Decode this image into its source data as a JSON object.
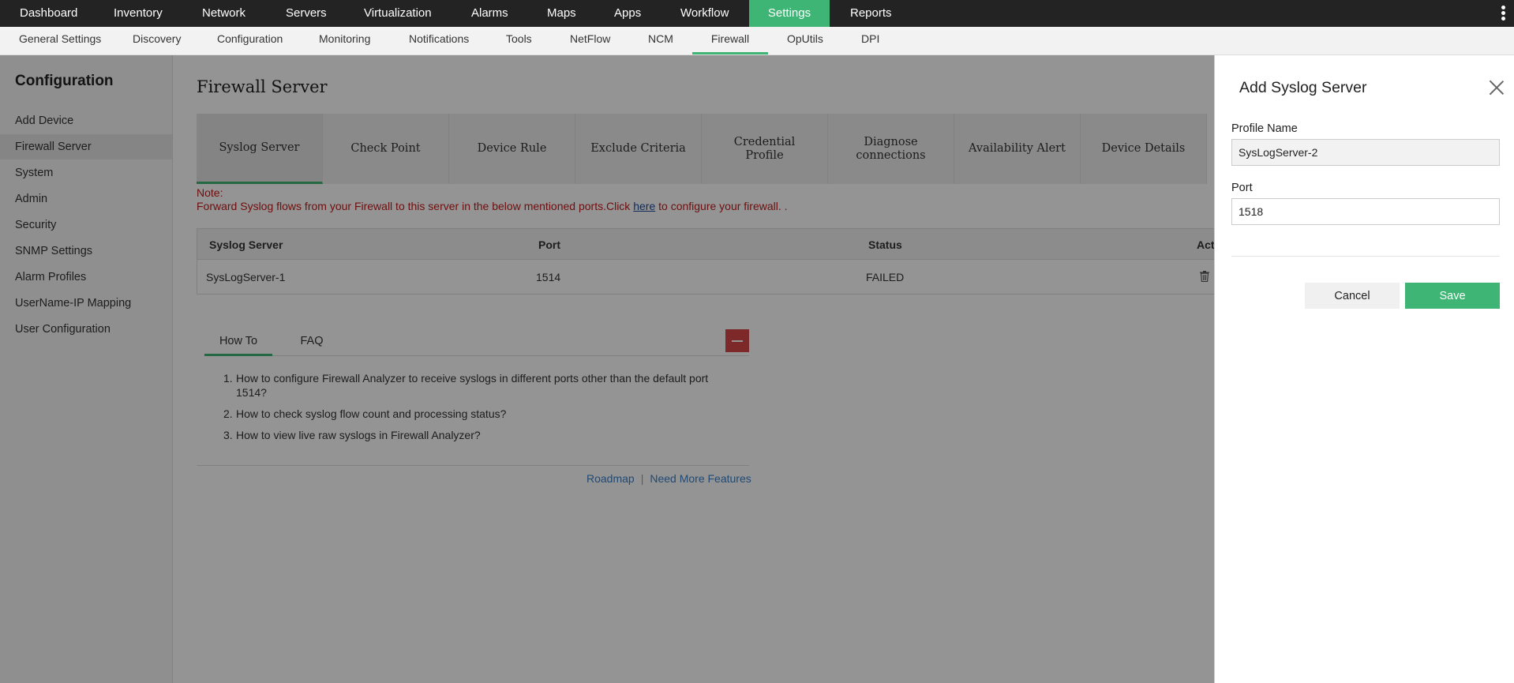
{
  "top_nav": {
    "items": [
      "Dashboard",
      "Inventory",
      "Network",
      "Servers",
      "Virtualization",
      "Alarms",
      "Maps",
      "Apps",
      "Workflow",
      "Settings",
      "Reports"
    ],
    "active": "Settings"
  },
  "sub_nav": {
    "items": [
      "General Settings",
      "Discovery",
      "Configuration",
      "Monitoring",
      "Notifications",
      "Tools",
      "NetFlow",
      "NCM",
      "Firewall",
      "OpUtils",
      "DPI"
    ],
    "active": "Firewall"
  },
  "sidebar": {
    "title": "Configuration",
    "items": [
      "Add Device",
      "Firewall Server",
      "System",
      "Admin",
      "Security",
      "SNMP Settings",
      "Alarm Profiles",
      "UserName-IP Mapping",
      "User Configuration"
    ],
    "active": "Firewall Server"
  },
  "main": {
    "title": "Firewall Server",
    "tabs": [
      "Syslog Server",
      "Check Point",
      "Device Rule",
      "Exclude Criteria",
      "Credential Profile",
      "Diagnose connections",
      "Availability Alert",
      "Device Details"
    ],
    "active_tab": "Syslog Server",
    "note_label": "Note:",
    "note_before": "Forward Syslog flows from your Firewall to this server in the below mentioned ports.Click ",
    "note_link": "here",
    "note_after": " to configure your firewall. .",
    "table": {
      "headers": [
        "Syslog Server",
        "Port",
        "Status",
        "Acti"
      ],
      "rows": [
        {
          "server": "SysLogServer-1",
          "port": "1514",
          "status": "FAILED"
        }
      ]
    },
    "help": {
      "tabs": [
        "How To",
        "FAQ"
      ],
      "active_tab": "How To",
      "items": [
        "How to configure Firewall Analyzer to receive syslogs in different ports other than the default port 1514?",
        "How to check syslog flow count and processing status?",
        "How to view live raw syslogs in Firewall Analyzer?"
      ],
      "numbers": [
        "1.",
        "2.",
        "3."
      ]
    },
    "footer": {
      "roadmap": "Roadmap",
      "separator": "|",
      "need_more": "Need More Features"
    }
  },
  "drawer": {
    "title": "Add Syslog Server",
    "profile_label": "Profile Name",
    "profile_value": "SysLogServer-2",
    "port_label": "Port",
    "port_value": "1518",
    "cancel": "Cancel",
    "save": "Save"
  },
  "colors": {
    "accent": "#3eb574",
    "topnav_bg": "#232323",
    "note_red": "#c21a1a",
    "link_blue": "#3b7fc4"
  }
}
